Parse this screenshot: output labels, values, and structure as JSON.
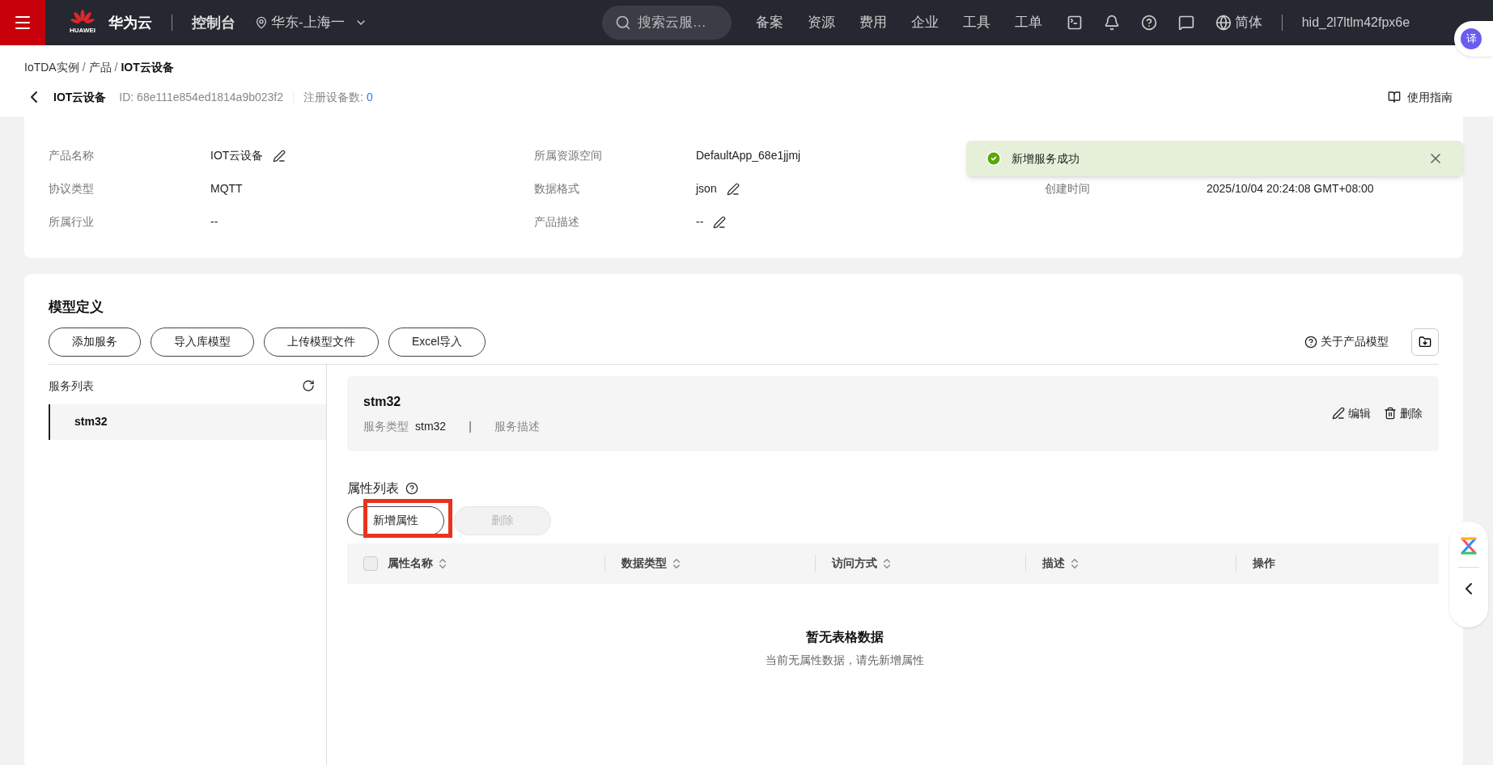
{
  "topbar": {
    "brand_mark": "HUAWEI",
    "brand": "华为云",
    "console": "控制台",
    "region": "华东-上海一",
    "search": {
      "placeholder": "搜索云服…"
    },
    "nav": [
      "备案",
      "资源",
      "费用",
      "企业",
      "工具",
      "工单"
    ],
    "language": "简体",
    "user": "hid_2l7ltlm42fpx6e"
  },
  "breadcrumb": [
    {
      "kind": "link",
      "label": "IoTDA实例"
    },
    {
      "kind": "separator",
      "label": "/"
    },
    {
      "kind": "link",
      "label": "产品"
    },
    {
      "kind": "separator",
      "label": "/"
    },
    {
      "kind": "current",
      "label": "IOT云设备"
    }
  ],
  "header": {
    "title": "IOT云设备",
    "id": "ID: 68e111e854ed1814a9b023f2",
    "device_count_label": "注册设备数:",
    "device_count": "0",
    "guide": "使用指南"
  },
  "details": {
    "columns": [
      [
        {
          "label": "产品名称",
          "value": "IOT云设备",
          "editable": true
        },
        {
          "label": "协议类型",
          "value": "MQTT",
          "editable": false
        },
        {
          "label": "所属行业",
          "value": "--",
          "editable": false
        }
      ],
      [
        {
          "label": "所属资源空间",
          "value": "DefaultApp_68e1jjmj",
          "editable": false
        },
        {
          "label": "数据格式",
          "value": "json",
          "editable": true
        },
        {
          "label": "产品描述",
          "value": "--",
          "editable": true
        }
      ],
      [
        {
          "label": "创建时间",
          "value": "2025/10/04 20:24:08 GMT+08:00",
          "editable": false
        }
      ]
    ]
  },
  "toast": {
    "message": "新增服务成功"
  },
  "model": {
    "title": "模型定义",
    "buttons": [
      "添加服务",
      "导入库模型",
      "上传模型文件",
      "Excel导入"
    ],
    "about": "关于产品模型",
    "service_list": {
      "title": "服务列表",
      "items": [
        {
          "name": "stm32",
          "selected": true
        }
      ]
    },
    "service": {
      "name": "stm32",
      "type_label": "服务类型",
      "type": "stm32",
      "separator": "|",
      "desc_label": "服务描述",
      "actions": [
        {
          "kind": "edit",
          "label": "编辑"
        },
        {
          "kind": "delete",
          "label": "删除"
        }
      ]
    },
    "properties": {
      "title": "属性列表",
      "add": "新增属性",
      "add_highlighted": true,
      "delete": {
        "label": "删除",
        "disabled": true
      },
      "select_all_checked": false,
      "columns": [
        {
          "label": "属性名称",
          "sortable": true
        },
        {
          "label": "数据类型",
          "sortable": true
        },
        {
          "label": "访问方式",
          "sortable": true
        },
        {
          "label": "描述",
          "sortable": true
        },
        {
          "label": "操作",
          "sortable": false
        }
      ],
      "empty_title": "暂无表格数据",
      "empty_hint": "当前无属性数据，请先新增属性"
    }
  },
  "side": {
    "translate": "译"
  }
}
